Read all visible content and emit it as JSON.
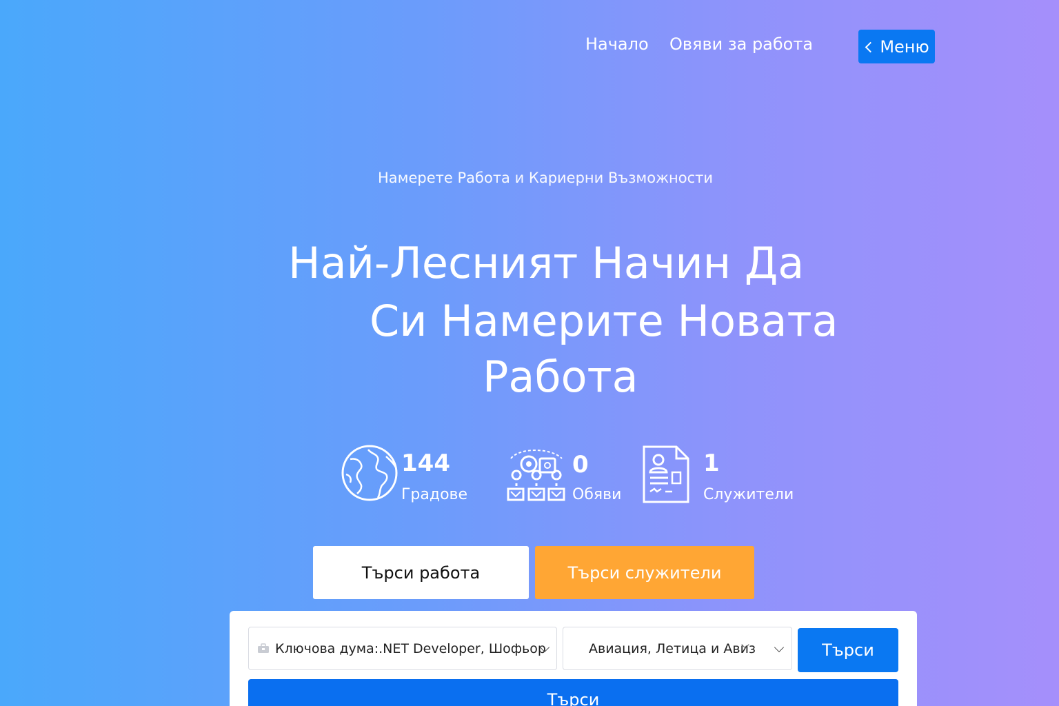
{
  "nav": {
    "home": "Начало",
    "jobs": "Овяви за работа",
    "menu": "Меню"
  },
  "hero": {
    "kicker": "Намерете Работа и Кариерни Възможности",
    "headline_line1": "Най-Лесният Начин Да",
    "headline_line2": "Си Намерите  Новата",
    "headline_line3": "Работа"
  },
  "stats": [
    {
      "icon": "globe-icon",
      "value": "144",
      "label": "Градове"
    },
    {
      "icon": "job-network-icon",
      "value": "0",
      "label": "Обяви"
    },
    {
      "icon": "resume-icon",
      "value": "1",
      "label": "Служители"
    }
  ],
  "tabs": {
    "jobs": "Търси работа",
    "employees": "Търси служители"
  },
  "search": {
    "keyword_placeholder": "Ключова дума:.NET Developer, Шофьор",
    "category_value": "Авиация, Летица и Авиз",
    "search_button": "Търси",
    "search_button_wide": "Търси"
  },
  "colors": {
    "gradient_start": "#4aa8fb",
    "gradient_end": "#a58ffb",
    "primary": "#0a78f2",
    "accent": "#ffa634"
  }
}
